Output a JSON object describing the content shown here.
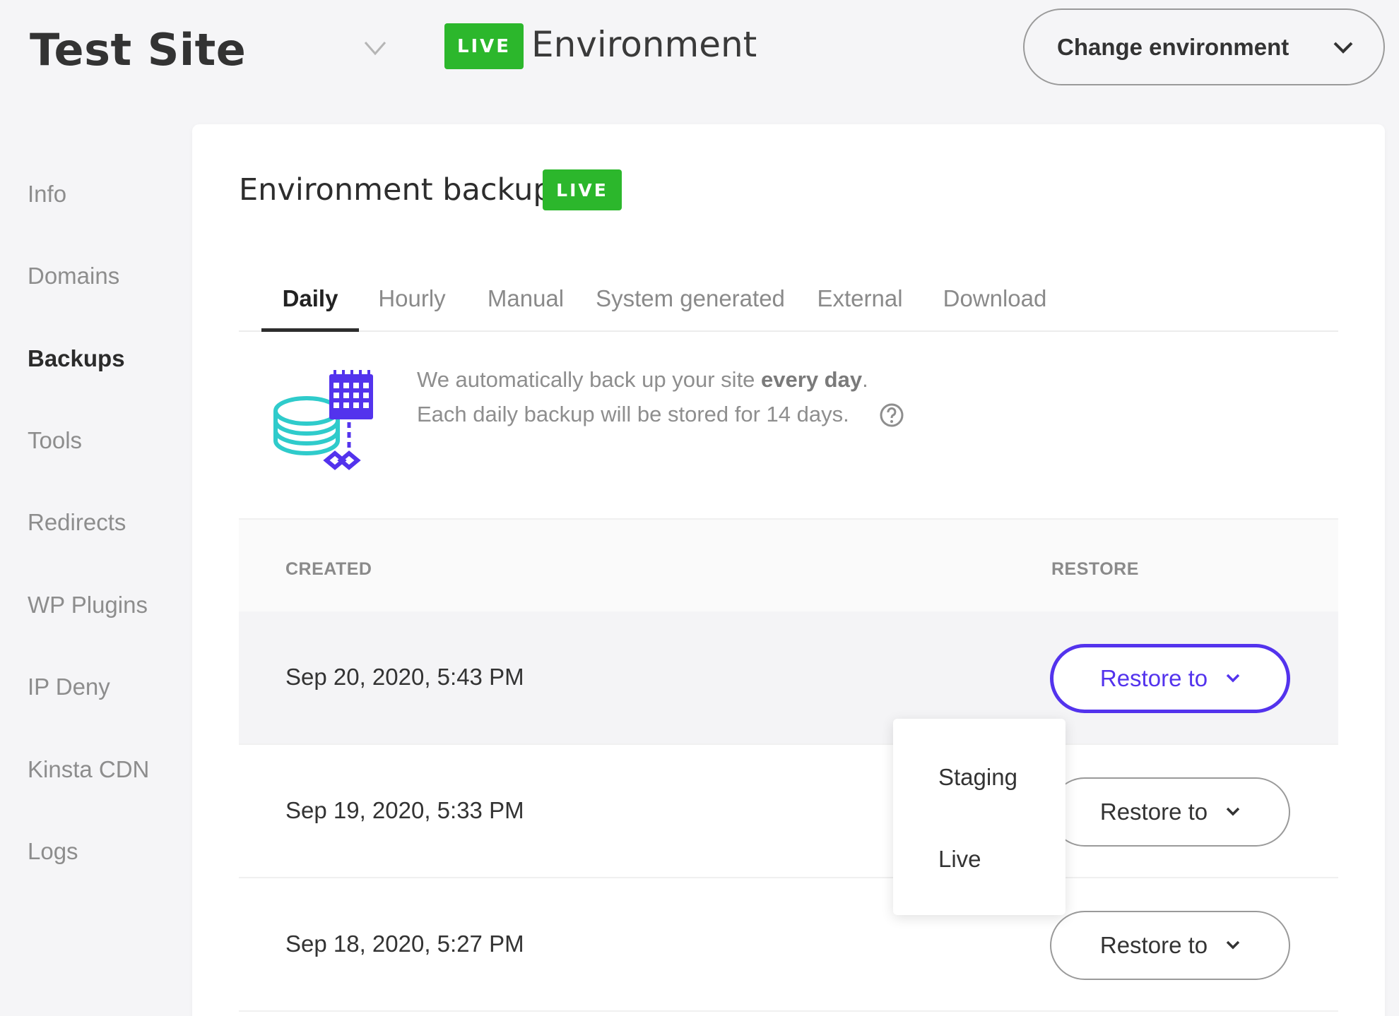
{
  "header": {
    "site_name": "Test Site",
    "env_badge": "LIVE",
    "env_label": "Environment",
    "change_env_label": "Change environment"
  },
  "sidebar": {
    "items": [
      {
        "label": "Info"
      },
      {
        "label": "Domains"
      },
      {
        "label": "Backups",
        "active": true
      },
      {
        "label": "Tools"
      },
      {
        "label": "Redirects"
      },
      {
        "label": "WP Plugins"
      },
      {
        "label": "IP Deny"
      },
      {
        "label": "Kinsta CDN"
      },
      {
        "label": "Logs"
      }
    ]
  },
  "main": {
    "title": "Environment backups",
    "badge": "LIVE",
    "tabs": [
      {
        "label": "Daily",
        "active": true
      },
      {
        "label": "Hourly"
      },
      {
        "label": "Manual"
      },
      {
        "label": "System generated"
      },
      {
        "label": "External"
      },
      {
        "label": "Download"
      }
    ],
    "info": {
      "line1_prefix": "We automatically back up your site ",
      "line1_bold": "every day",
      "line1_suffix": ".",
      "line2": "Each daily backup will be stored for 14 days."
    },
    "table": {
      "headers": {
        "created": "CREATED",
        "restore": "RESTORE"
      },
      "rows": [
        {
          "date": "Sep 20, 2020, 5:43 PM",
          "restore_label": "Restore to"
        },
        {
          "date": "Sep 19, 2020, 5:33 PM",
          "restore_label": "Restore to"
        },
        {
          "date": "Sep 18, 2020, 5:27 PM",
          "restore_label": "Restore to"
        }
      ]
    },
    "dropdown": {
      "options": [
        "Staging",
        "Live"
      ]
    }
  },
  "colors": {
    "live_green": "#2cb72c",
    "accent_purple": "#5333ed",
    "illustration_teal": "#2fcbcb",
    "illustration_indigo": "#5333ed"
  },
  "icons": {
    "site_chevron": "chevron-down-icon",
    "env_chevron": "chevron-down-icon",
    "illustration": "database-calendar-icon",
    "help": "question-circle-icon"
  }
}
